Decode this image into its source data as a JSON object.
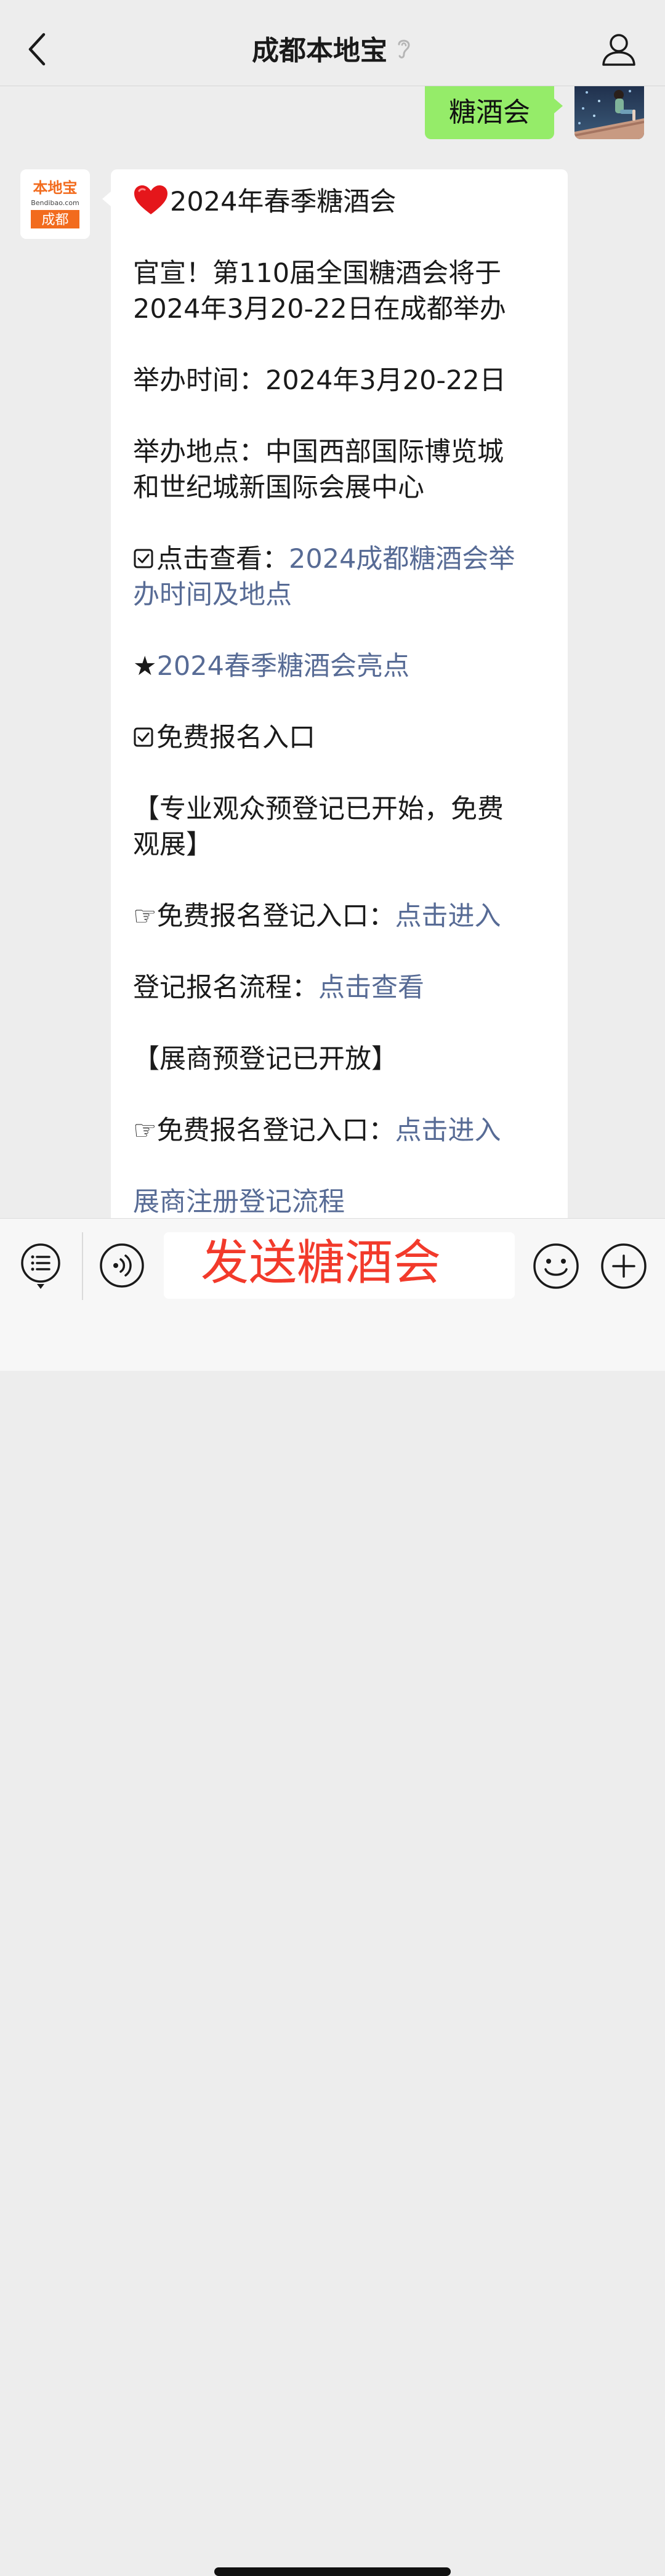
{
  "header": {
    "title": "成都本地宝"
  },
  "chat": {
    "user_message": "糖酒会",
    "bot_logo": {
      "brand": "本地宝",
      "domain": "Bendibao.com",
      "city": "成都"
    },
    "bot_message": {
      "title_line": "2024年春季糖酒会",
      "announce_line1": "官宣！第110届全国糖酒会将于",
      "announce_line2": "2024年3月20-22日在成都举办",
      "time_line": "举办时间：2024年3月20-22日",
      "place_line1": "举办地点：中国西部国际博览城",
      "place_line2": "和世纪城新国际会展中心",
      "view_prefix": "点击查看：",
      "view_link_line1": "2024成都糖酒会举",
      "view_link_line2": "办时间及地点",
      "highlight_prefix": "★",
      "highlight_link": "2024春季糖酒会亮点",
      "free_entry": "免费报名入口",
      "audience_line1": "【专业观众预登记已开始，免费",
      "audience_line2": "观展】",
      "register_prefix_1": "☞免费报名登记入口：",
      "register_link_1": "点击进入",
      "process_prefix": "登记报名流程：",
      "process_link": "点击查看",
      "exhibitor_line": "【展商预登记已开放】",
      "register_prefix_2": "☞免费报名登记入口：",
      "register_link_2": "点击进入",
      "exhibitor_process_link": "展商注册登记流程"
    }
  },
  "input": {
    "value": "发送糖酒会"
  },
  "colors": {
    "background": "#ededed",
    "user_bubble": "#95ec69",
    "link": "#576b95",
    "input_text": "#f23a2b",
    "logo_orange": "#f26b1d"
  },
  "icons": {
    "back": "chevron-left-icon",
    "ear": "ear-icon",
    "profile": "person-icon",
    "menu": "menu-list-icon",
    "voice": "voice-icon",
    "emoji": "emoji-icon",
    "plus": "plus-circle-icon"
  }
}
